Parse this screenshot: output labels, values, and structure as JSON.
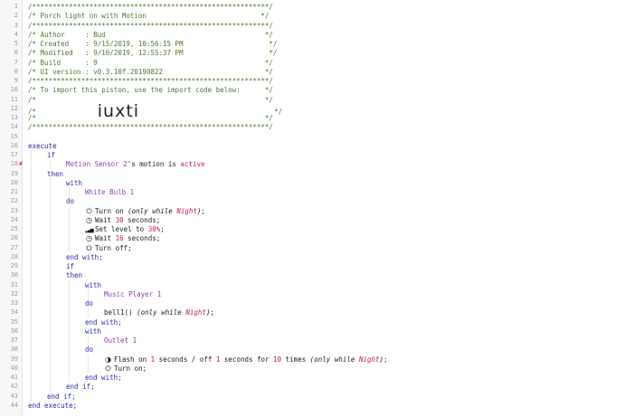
{
  "lines": [
    {
      "n": "1",
      "indent": 0,
      "parts": [
        {
          "t": "/**********************************************************/",
          "c": "comment"
        }
      ]
    },
    {
      "n": "2",
      "indent": 0,
      "parts": [
        {
          "t": "/* Porch light on with Motion                            */",
          "c": "comment"
        }
      ]
    },
    {
      "n": "3",
      "indent": 0,
      "parts": [
        {
          "t": "/**********************************************************/",
          "c": "comment"
        }
      ]
    },
    {
      "n": "4",
      "indent": 0,
      "parts": [
        {
          "t": "/* Author     : Bud                                       */",
          "c": "comment"
        }
      ]
    },
    {
      "n": "5",
      "indent": 0,
      "parts": [
        {
          "t": "/* Created    : 9/15/2019, 10:56:15 PM                     */",
          "c": "comment"
        }
      ]
    },
    {
      "n": "6",
      "indent": 0,
      "parts": [
        {
          "t": "/* Modified   : 9/16/2019, 12:55:37 PM                     */",
          "c": "comment"
        }
      ]
    },
    {
      "n": "7",
      "indent": 0,
      "parts": [
        {
          "t": "/* Build      : 9                                         */",
          "c": "comment"
        }
      ]
    },
    {
      "n": "8",
      "indent": 0,
      "parts": [
        {
          "t": "/* UI version : v0.3.10f.20190822                         */",
          "c": "comment"
        }
      ]
    },
    {
      "n": "9",
      "indent": 0,
      "parts": [
        {
          "t": "/**********************************************************/",
          "c": "comment"
        }
      ]
    },
    {
      "n": "10",
      "indent": 0,
      "parts": [
        {
          "t": "/* To import this piston, use the import code below:      */",
          "c": "comment"
        }
      ]
    },
    {
      "n": "11",
      "indent": 0,
      "parts": [
        {
          "t": "/*                                                        */",
          "c": "comment"
        }
      ]
    },
    {
      "n": "12",
      "indent": 0,
      "parts": [
        {
          "t": "/*               ",
          "c": "comment"
        },
        {
          "t": "iuxti",
          "c": "big"
        },
        {
          "t": "                                 */",
          "c": "comment"
        }
      ]
    },
    {
      "n": "13",
      "indent": 0,
      "parts": [
        {
          "t": "/*                                                        */",
          "c": "comment"
        }
      ]
    },
    {
      "n": "14",
      "indent": 0,
      "parts": [
        {
          "t": "/**********************************************************/",
          "c": "comment"
        }
      ]
    },
    {
      "n": "15",
      "indent": 0,
      "parts": []
    },
    {
      "n": "16",
      "indent": 0,
      "parts": [
        {
          "t": "execute",
          "c": "kw"
        }
      ]
    },
    {
      "n": "17",
      "indent": 1,
      "parts": [
        {
          "t": "if",
          "c": "kw"
        }
      ]
    },
    {
      "n": "18",
      "indent": 2,
      "mark": "✘",
      "parts": [
        {
          "t": "Motion Sensor 2",
          "c": "dev"
        },
        {
          "t": "'s motion is ",
          "c": ""
        },
        {
          "t": "active",
          "c": "hl"
        }
      ]
    },
    {
      "n": "19",
      "indent": 1,
      "parts": [
        {
          "t": "then",
          "c": "kw"
        }
      ]
    },
    {
      "n": "20",
      "indent": 2,
      "parts": [
        {
          "t": "with",
          "c": "kw"
        }
      ]
    },
    {
      "n": "21",
      "indent": 3,
      "parts": [
        {
          "t": "White Bulb 1",
          "c": "dev"
        }
      ]
    },
    {
      "n": "22",
      "indent": 2,
      "parts": [
        {
          "t": "do",
          "c": "kw"
        }
      ]
    },
    {
      "n": "23",
      "indent": 3,
      "icon": "power",
      "parts": [
        {
          "t": "Turn on ",
          "c": ""
        },
        {
          "t": "(only while ",
          "c": "italic"
        },
        {
          "t": "Night",
          "c": "italic hl"
        },
        {
          "t": ")",
          "c": "italic"
        },
        {
          "t": ";",
          "c": ""
        }
      ]
    },
    {
      "n": "24",
      "indent": 3,
      "icon": "clock",
      "parts": [
        {
          "t": "Wait ",
          "c": ""
        },
        {
          "t": "30",
          "c": "num"
        },
        {
          "t": " seconds;",
          "c": ""
        }
      ]
    },
    {
      "n": "25",
      "indent": 3,
      "icon": "level",
      "parts": [
        {
          "t": "Set level to ",
          "c": ""
        },
        {
          "t": "30%",
          "c": "num"
        },
        {
          "t": ";",
          "c": ""
        }
      ]
    },
    {
      "n": "26",
      "indent": 3,
      "icon": "clock",
      "parts": [
        {
          "t": "Wait ",
          "c": ""
        },
        {
          "t": "16",
          "c": "num"
        },
        {
          "t": " seconds;",
          "c": ""
        }
      ]
    },
    {
      "n": "27",
      "indent": 3,
      "icon": "power-off",
      "parts": [
        {
          "t": "Turn off;",
          "c": ""
        }
      ]
    },
    {
      "n": "28",
      "indent": 2,
      "parts": [
        {
          "t": "end with;",
          "c": "kw"
        }
      ]
    },
    {
      "n": "29",
      "indent": 2,
      "parts": [
        {
          "t": "if",
          "c": "kw"
        }
      ]
    },
    {
      "n": "30",
      "indent": 2,
      "parts": [
        {
          "t": "then",
          "c": "kw"
        }
      ]
    },
    {
      "n": "31",
      "indent": 3,
      "parts": [
        {
          "t": "with",
          "c": "kw"
        }
      ]
    },
    {
      "n": "32",
      "indent": 4,
      "parts": [
        {
          "t": "Music Player 1",
          "c": "dev"
        }
      ]
    },
    {
      "n": "33",
      "indent": 3,
      "parts": [
        {
          "t": "do",
          "c": "kw"
        }
      ]
    },
    {
      "n": "34",
      "indent": 4,
      "parts": [
        {
          "t": "bell1() ",
          "c": ""
        },
        {
          "t": "(only while ",
          "c": "italic"
        },
        {
          "t": "Night",
          "c": "italic hl"
        },
        {
          "t": ")",
          "c": "italic"
        },
        {
          "t": ";",
          "c": ""
        }
      ]
    },
    {
      "n": "35",
      "indent": 3,
      "parts": [
        {
          "t": "end with;",
          "c": "kw"
        }
      ]
    },
    {
      "n": "36",
      "indent": 3,
      "parts": [
        {
          "t": "with",
          "c": "kw"
        }
      ]
    },
    {
      "n": "37",
      "indent": 4,
      "parts": [
        {
          "t": "Outlet 1",
          "c": "dev"
        }
      ]
    },
    {
      "n": "38",
      "indent": 3,
      "parts": [
        {
          "t": "do",
          "c": "kw"
        }
      ]
    },
    {
      "n": "39",
      "indent": 4,
      "icon": "flash",
      "parts": [
        {
          "t": "Flash on ",
          "c": ""
        },
        {
          "t": "1",
          "c": "num"
        },
        {
          "t": " seconds / off ",
          "c": ""
        },
        {
          "t": "1",
          "c": "num"
        },
        {
          "t": " seconds for ",
          "c": ""
        },
        {
          "t": "10",
          "c": "num"
        },
        {
          "t": " times ",
          "c": ""
        },
        {
          "t": "(only while ",
          "c": "italic"
        },
        {
          "t": "Night",
          "c": "italic hl"
        },
        {
          "t": ")",
          "c": "italic"
        },
        {
          "t": ";",
          "c": ""
        }
      ]
    },
    {
      "n": "40",
      "indent": 4,
      "icon": "power",
      "parts": [
        {
          "t": "Turn on;",
          "c": ""
        }
      ]
    },
    {
      "n": "41",
      "indent": 3,
      "parts": [
        {
          "t": "end with;",
          "c": "kw"
        }
      ]
    },
    {
      "n": "42",
      "indent": 2,
      "parts": [
        {
          "t": "end if;",
          "c": "kw"
        }
      ]
    },
    {
      "n": "43",
      "indent": 1,
      "parts": [
        {
          "t": "end if;",
          "c": "kw"
        }
      ]
    },
    {
      "n": "44",
      "indent": 0,
      "parts": [
        {
          "t": "end execute;",
          "c": "kw"
        }
      ]
    }
  ],
  "icons": {
    "power": "⏻",
    "clock": "◷",
    "level": "▂▄▆",
    "power-off": "⭘",
    "flash": "◑"
  },
  "colors": {
    "comment": "#4b7a2c",
    "keyword": "#2a2aa8",
    "device": "#8a3fb0",
    "value": "#c02050"
  }
}
